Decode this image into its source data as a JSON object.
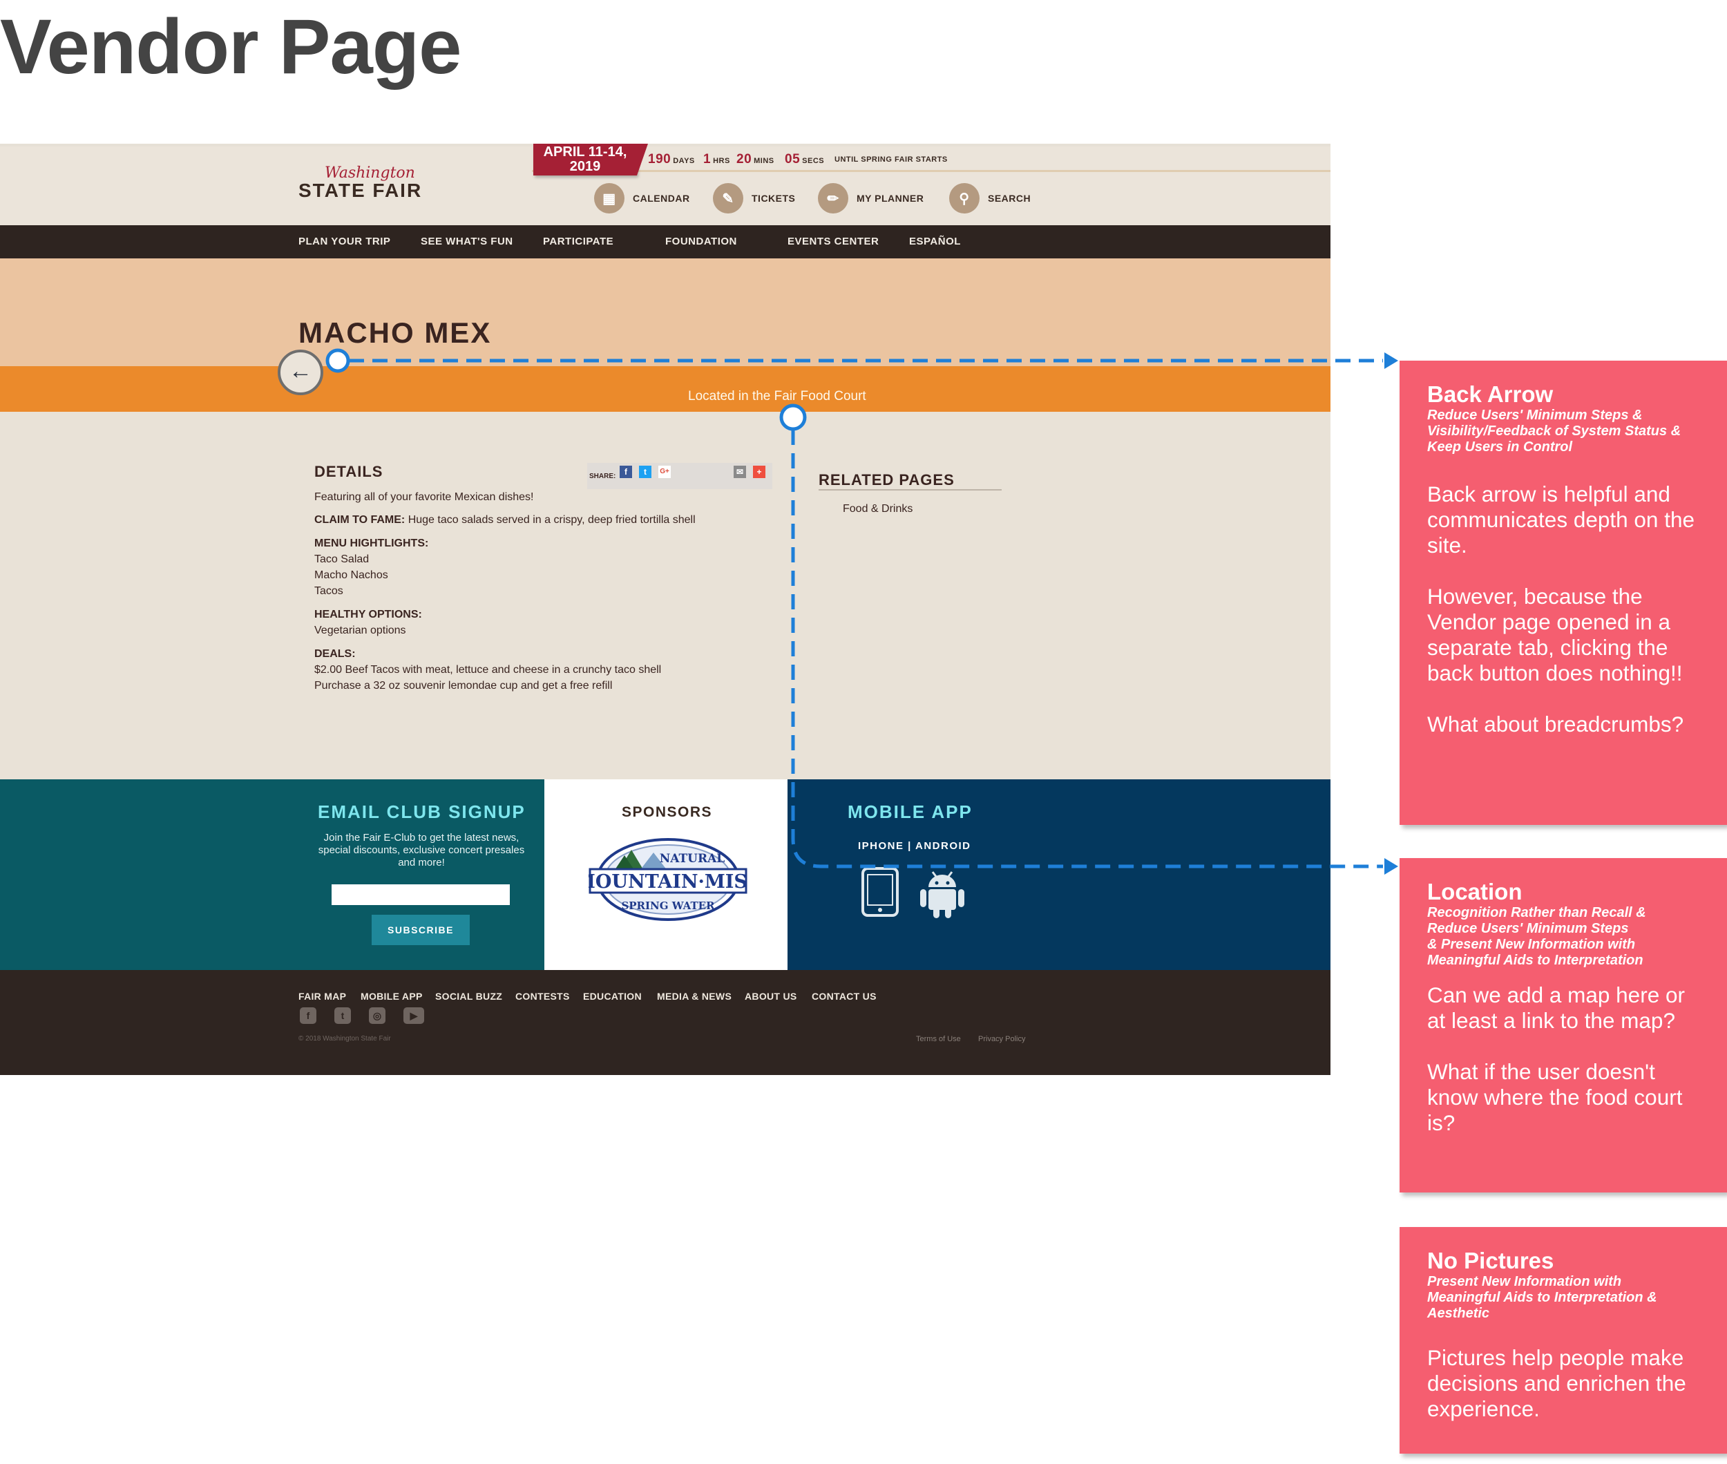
{
  "page_title": "Vendor Page",
  "site": {
    "date_banner": {
      "line1": "APRIL 11-14,",
      "line2": "2019"
    },
    "countdown": {
      "days": "190",
      "days_label": "DAYS",
      "hrs": "1",
      "hrs_label": "HRS",
      "mins": "20",
      "mins_label": "MINS",
      "secs": "05",
      "secs_label": "SECS",
      "suffix": "UNTIL SPRING FAIR STARTS"
    },
    "logo": {
      "script": "Washington",
      "main": "STATE FAIR"
    },
    "utility_nav": [
      "CALENDAR",
      "TICKETS",
      "MY PLANNER",
      "SEARCH"
    ],
    "main_nav": [
      "PLAN YOUR TRIP",
      "SEE WHAT'S FUN",
      "PARTICIPATE",
      "FOUNDATION",
      "EVENTS CENTER",
      "ESPAÑOL"
    ],
    "vendor_name": "MACHO MEX",
    "location": "Located in the Fair Food Court",
    "details": {
      "heading": "DETAILS",
      "share_label": "SHARE:",
      "intro": "Featuring all of your favorite Mexican dishes!",
      "claim_label": "CLAIM TO FAME:",
      "claim_text": "Huge taco salads served in a crispy, deep fried tortilla shell",
      "menu_label": "MENU HIGHTLIGHTS:",
      "menu_items": [
        "Taco Salad",
        "Macho Nachos",
        "Tacos"
      ],
      "healthy_label": "HEALTHY OPTIONS:",
      "healthy_text": "Vegetarian options",
      "deals_label": "DEALS:",
      "deals": [
        "$2.00 Beef Tacos with meat, lettuce and cheese in a crunchy taco shell",
        "Purchase a 32 oz souvenir lemondae cup and get a free refill"
      ]
    },
    "related": {
      "heading": "RELATED PAGES",
      "items": [
        "Food & Drinks"
      ]
    },
    "email_club": {
      "heading": "EMAIL CLUB SIGNUP",
      "description": "Join the Fair E-Club to get the latest news, special discounts, exclusive concert presales and more!",
      "input_value": "",
      "button": "SUBSCRIBE"
    },
    "sponsors": {
      "heading": "SPONSORS",
      "logo": {
        "top": "NATURAL",
        "main": "MOUNTAIN·MIST",
        "bottom": "SPRING WATER"
      }
    },
    "mobile_app": {
      "heading": "MOBILE APP",
      "links": "IPHONE | ANDROID"
    },
    "footer": {
      "links": [
        "FAIR MAP",
        "MOBILE APP",
        "SOCIAL BUZZ",
        "CONTESTS",
        "EDUCATION",
        "MEDIA & NEWS",
        "ABOUT US",
        "CONTACT US"
      ],
      "copyright": "© 2018 Washington State Fair",
      "terms": "Terms of Use",
      "privacy": "Privacy Policy"
    }
  },
  "annotations": [
    {
      "title": "Back Arrow",
      "heuristics": "Reduce Users' Minimum Steps &\nVisibility/Feedback of System Status &\nKeep Users in Control",
      "body": "Back arrow is helpful and communicates depth on the site.\n\nHowever, because the Vendor page opened in a separate tab, clicking the back button does nothing!!\n\nWhat about breadcrumbs?"
    },
    {
      "title": "Location",
      "heuristics": "Recognition Rather than Recall &\nReduce Users' Minimum Steps\n& Present New Information with\nMeaningful Aids to Interpretation",
      "body": "Can we add a map here or at least a link to the map?\n\nWhat if the user doesn't know where the food court is?"
    },
    {
      "title": "No Pictures",
      "heuristics": "Present New Information with\nMeaningful Aids to Interpretation &\nAesthetic",
      "body": "Pictures help people make decisions and enrichen the experience."
    }
  ],
  "colors": {
    "annotation_card": "#f55e70",
    "callout_line": "#1e7fd8",
    "brand_red": "#a52035",
    "location_band": "#eb8a2b",
    "nav_dark": "#2e2420",
    "email_teal": "#0a5a64",
    "mobile_navy": "#04385e"
  }
}
